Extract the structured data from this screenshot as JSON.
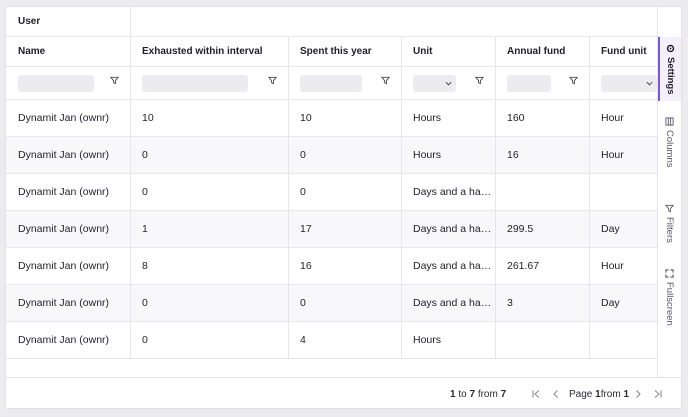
{
  "group_header": "User",
  "columns": [
    {
      "key": "name",
      "label": "Name",
      "filter": "text"
    },
    {
      "key": "exhausted",
      "label": "Exhausted within interval",
      "filter": "text"
    },
    {
      "key": "spent",
      "label": "Spent this year",
      "filter": "text"
    },
    {
      "key": "unit",
      "label": "Unit",
      "filter": "select"
    },
    {
      "key": "annual",
      "label": "Annual fund",
      "filter": "text"
    },
    {
      "key": "fund_unit",
      "label": "Fund unit",
      "filter": "select"
    }
  ],
  "rows": [
    {
      "name": "Dynamit Jan (ownr)",
      "exhausted": "10",
      "spent": "10",
      "unit": "Hours",
      "annual": "160",
      "fund_unit": "Hour"
    },
    {
      "name": "Dynamit Jan (ownr)",
      "exhausted": "0",
      "spent": "0",
      "unit": "Hours",
      "annual": "16",
      "fund_unit": "Hour"
    },
    {
      "name": "Dynamit Jan (ownr)",
      "exhausted": "0",
      "spent": "0",
      "unit": "Days and a ha…",
      "annual": "",
      "fund_unit": ""
    },
    {
      "name": "Dynamit Jan (ownr)",
      "exhausted": "1",
      "spent": "17",
      "unit": "Days and a ha…",
      "annual": "299.5",
      "fund_unit": "Day"
    },
    {
      "name": "Dynamit Jan (ownr)",
      "exhausted": "8",
      "spent": "16",
      "unit": "Days and a ha…",
      "annual": "261.67",
      "fund_unit": "Hour"
    },
    {
      "name": "Dynamit Jan (ownr)",
      "exhausted": "0",
      "spent": "0",
      "unit": "Days and a ha…",
      "annual": "3",
      "fund_unit": "Day"
    },
    {
      "name": "Dynamit Jan (ownr)",
      "exhausted": "0",
      "spent": "4",
      "unit": "Hours",
      "annual": "",
      "fund_unit": ""
    }
  ],
  "side_panel": {
    "settings": "Settings",
    "columns": "Columns",
    "filters": "Filters",
    "fullscreen": "Fullscreen"
  },
  "pagination": {
    "range_from": "1",
    "range_to": "7",
    "total": "7",
    "to_word": "to",
    "from_word": "from",
    "page_word": "Page",
    "page_current": "1",
    "page_total": "1"
  },
  "colors": {
    "accent": "#7b5ccf",
    "row_alt": "#f8f8fa",
    "border": "#e6e6eb"
  }
}
